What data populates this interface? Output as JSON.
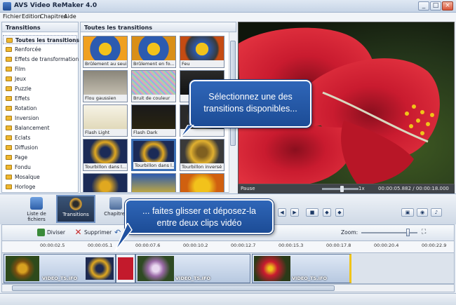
{
  "window": {
    "title": "AVS Video ReMaker 4.0",
    "min": "_",
    "max": "□",
    "close": "×"
  },
  "menu": [
    "Fichier",
    "Edition",
    "Chapitres",
    "Aide"
  ],
  "transitions_panel": {
    "title": "Transitions",
    "items": [
      "Toutes les transitions",
      "Renforcée",
      "Effets de transformation",
      "Film",
      "Jeux",
      "Puzzle",
      "Effets",
      "Rotation",
      "Inversion",
      "Balancement",
      "Eclats",
      "Diffusion",
      "Page",
      "Fondu",
      "Mosaïque",
      "Horloge"
    ]
  },
  "grid_panel": {
    "title": "Toutes les transitions",
    "thumbs": [
      "Brûlement au seuil",
      "Brûlement en fo...",
      "Feu",
      "Flou gaussien",
      "Bruit de couleur",
      "",
      "Flash Light",
      "Flash Dark",
      "",
      "Tourbillon dans l...",
      "Tourbillon dans l...",
      "Tourbillon inversé",
      "",
      "",
      ""
    ]
  },
  "preview": {
    "state": "Pause",
    "speed": "1x",
    "time": "00:00:05.882 / 00:00:18.000"
  },
  "toolbar": {
    "files": "Liste de fichiers",
    "transitions": "Transitions",
    "chapters": "Chapitres"
  },
  "timeline": {
    "split": "Diviser",
    "delete": "Supprimer",
    "zoom": "Zoom:",
    "ticks": [
      "00:00:02.5",
      "00:00:05.1",
      "00:00:07.6",
      "00:00:10.2",
      "00:00:12.7",
      "00:00:15.3",
      "00:00:17.8",
      "00:00:20.4",
      "00:00:22.9"
    ],
    "clips": [
      "VIDEO_TS.IFO",
      "VIDEO_TS.IFO",
      "VIDEO_TS.IFO"
    ]
  },
  "callouts": {
    "top": "Sélectionnez une des transitions disponibles...",
    "bottom": "... faites glisser et déposez-la entre deux clips vidéo"
  },
  "colors": {
    "accent": "#2f66b8",
    "flower": "#d01e2e",
    "swirl": "#e0a820"
  }
}
